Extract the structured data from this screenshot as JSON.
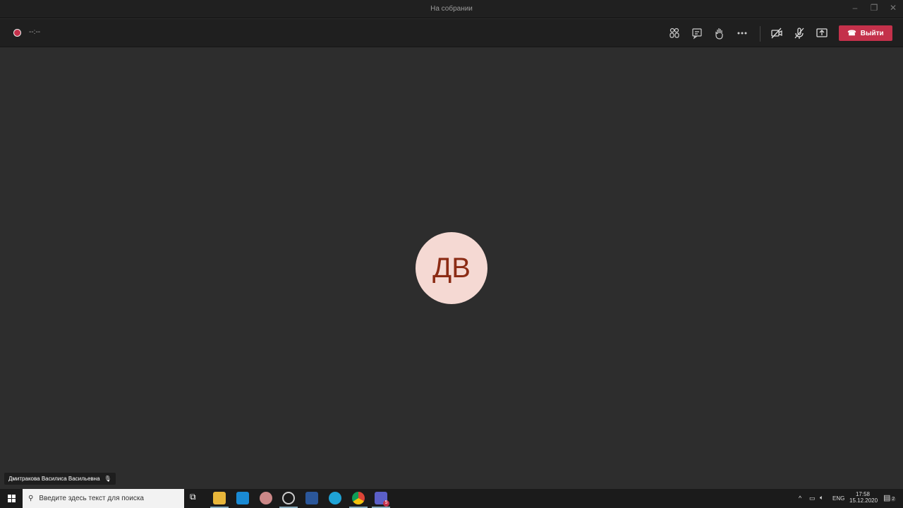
{
  "window": {
    "title": "На собрании",
    "minimize": "–",
    "maximize": "❐",
    "close": "✕"
  },
  "toolbar": {
    "timer": "--:--",
    "leave_label": "Выйти",
    "icons": [
      "participants-icon",
      "chat-icon",
      "raise-hand-icon",
      "more-icon",
      "camera-off-icon",
      "mic-off-icon",
      "share-screen-icon"
    ]
  },
  "participant": {
    "initials": "ДВ",
    "name": "Дмитракова Василиса Васильевна",
    "avatar_bg": "#f5d9d3",
    "avatar_fg": "#8b2b14"
  },
  "taskbar": {
    "search_placeholder": "Введите здесь текст для поиска",
    "language": "ENG",
    "time": "17:58",
    "date": "15.12.2020",
    "notifications": "2",
    "teams_badge": "5"
  },
  "colors": {
    "accent": "#c4314b"
  }
}
